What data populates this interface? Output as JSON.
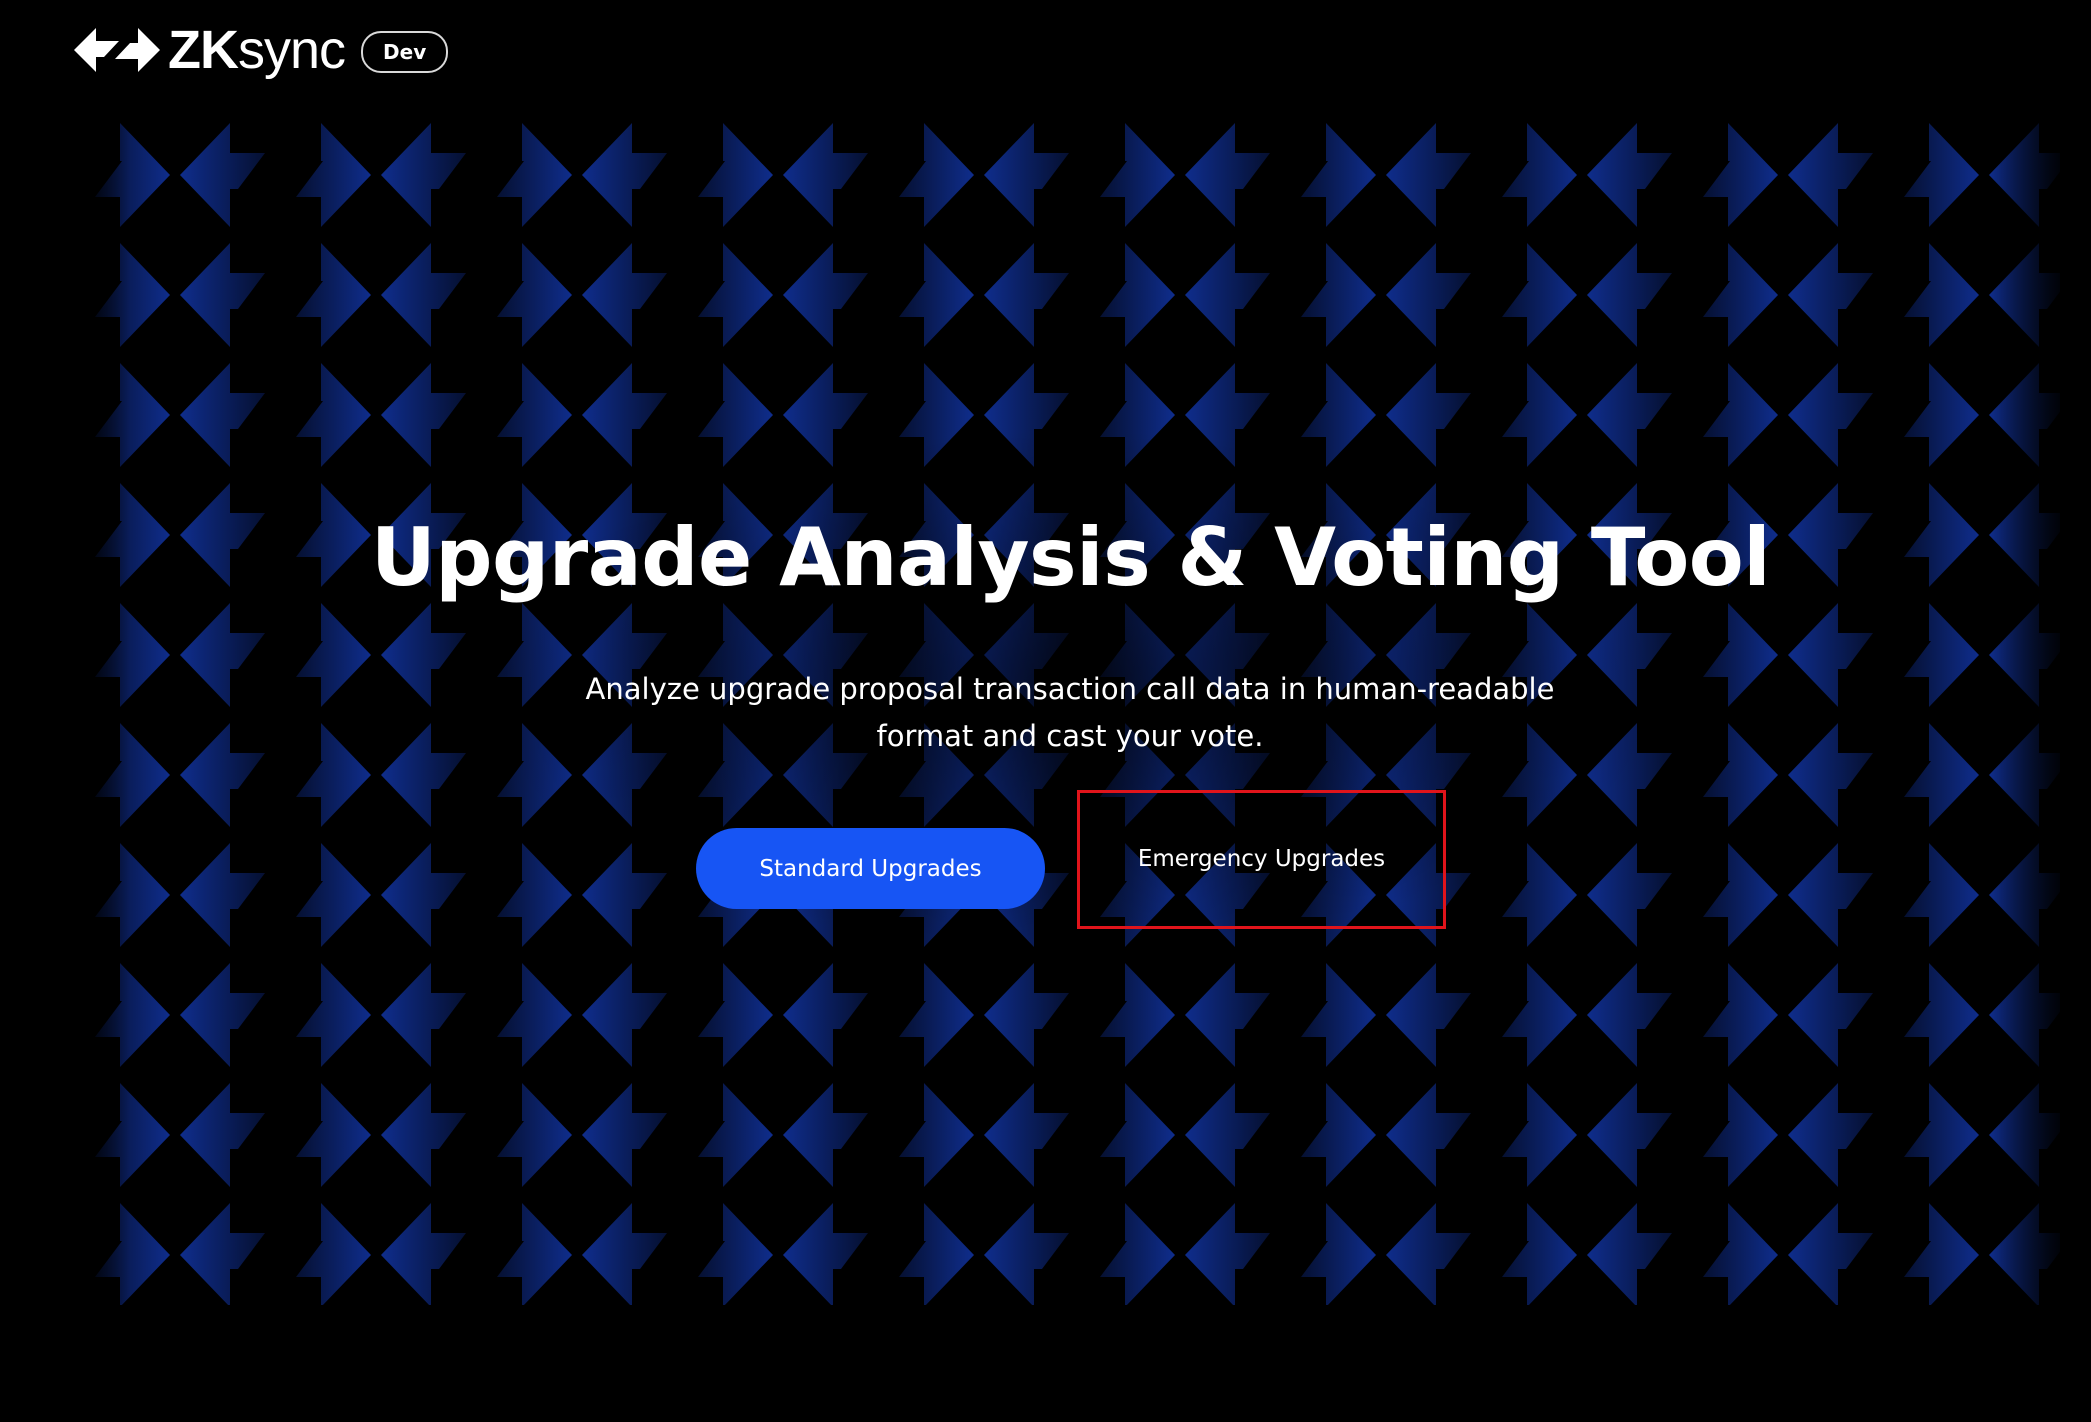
{
  "header": {
    "brand_prefix": "ZK",
    "brand_suffix": "sync",
    "logo_icon": "zksync-arrows-logo",
    "environment_badge": "Dev"
  },
  "hero": {
    "title": "Upgrade Analysis & Voting Tool",
    "subtitle": "Analyze upgrade proposal transaction call data in human-readable format and cast your vote.",
    "background_pattern": "zksync-arrows-pattern"
  },
  "actions": {
    "standard_label": "Standard Upgrades",
    "emergency_label": "Emergency Upgrades"
  },
  "colors": {
    "background": "#000000",
    "primary_button": "#1755f4",
    "pattern_arrow": "#0f2d8c",
    "highlight_border": "#e0141b",
    "text": "#ffffff"
  }
}
